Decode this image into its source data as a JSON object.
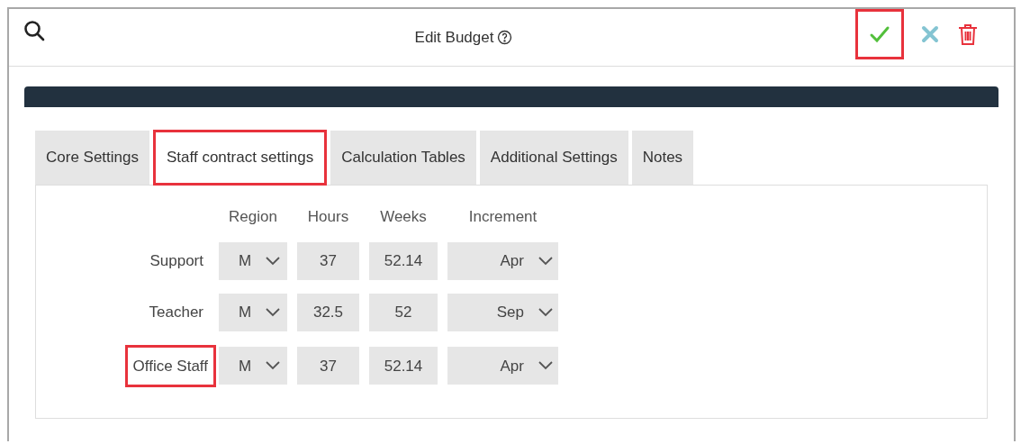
{
  "header": {
    "title": "Edit Budget",
    "save_highlighted": true
  },
  "tabs": [
    {
      "label": "Core Settings",
      "selected": false,
      "highlighted": false
    },
    {
      "label": "Staff contract settings",
      "selected": true,
      "highlighted": true
    },
    {
      "label": "Calculation Tables",
      "selected": false,
      "highlighted": false
    },
    {
      "label": "Additional Settings",
      "selected": false,
      "highlighted": false
    },
    {
      "label": "Notes",
      "selected": false,
      "highlighted": false
    }
  ],
  "table": {
    "columns": [
      "Region",
      "Hours",
      "Weeks",
      "Increment"
    ],
    "rows": [
      {
        "label": "Support",
        "highlighted": false,
        "region": "M",
        "hours": "37",
        "weeks": "52.14",
        "increment": "Apr"
      },
      {
        "label": "Teacher",
        "highlighted": false,
        "region": "M",
        "hours": "32.5",
        "weeks": "52",
        "increment": "Sep"
      },
      {
        "label": "Office Staff",
        "highlighted": true,
        "region": "M",
        "hours": "37",
        "weeks": "52.14",
        "increment": "Apr"
      }
    ]
  }
}
